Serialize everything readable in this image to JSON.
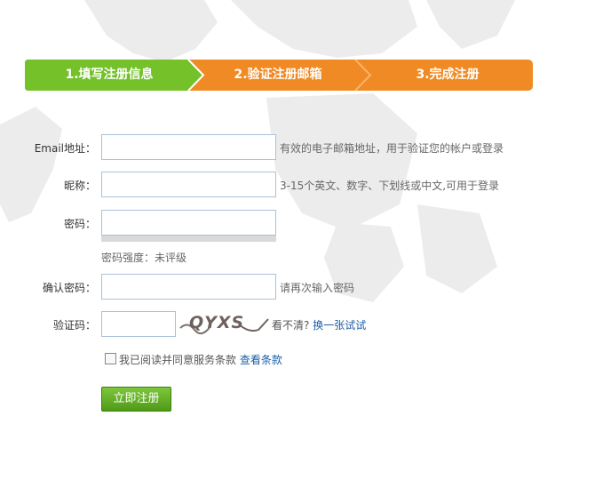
{
  "steps": [
    {
      "label": "1.填写注册信息",
      "color": "#74c12a"
    },
    {
      "label": "2.验证注册邮箱",
      "color": "#f08a24"
    },
    {
      "label": "3.完成注册",
      "color": "#f08a24"
    }
  ],
  "form": {
    "email": {
      "label": "Email地址：",
      "value": "",
      "hint": "有效的电子邮箱地址，用于验证您的帐户或登录"
    },
    "nickname": {
      "label": "昵称：",
      "value": "",
      "hint": "3-15个英文、数字、下划线或中文,可用于登录"
    },
    "password": {
      "label": "密码：",
      "value": "",
      "strength_label": "密码强度：",
      "strength_value": "未评级"
    },
    "confirm": {
      "label": "确认密码：",
      "value": "",
      "hint": "请再次输入密码"
    },
    "captcha": {
      "label": "验证码：",
      "value": "",
      "image_text": "QYXS",
      "unclear_text": "看不清?",
      "refresh_link": "换一张试试"
    },
    "agree": {
      "text": "我已阅读并同意服务条款",
      "link": "查看条款",
      "checked": false
    },
    "submit_label": "立即注册"
  },
  "colors": {
    "active_step": "#74c12a",
    "inactive_step": "#f08a24",
    "link": "#1a5ea8",
    "button": "#5ea81f"
  }
}
